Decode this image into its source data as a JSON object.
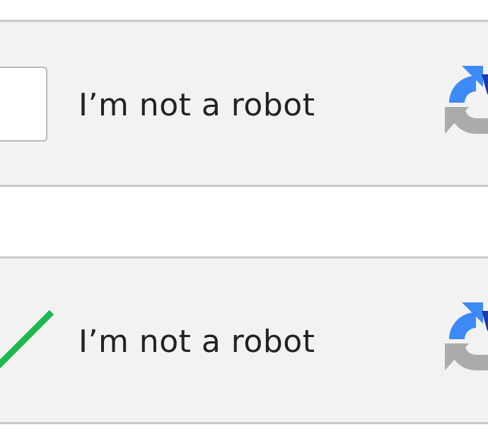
{
  "captcha_unchecked": {
    "label": "I’m not a robot",
    "checked": false
  },
  "captcha_checked": {
    "label": "I’m not a robot",
    "checked": true
  },
  "colors": {
    "widget_bg": "#f2f2f2",
    "widget_border": "#c9c9c9",
    "checkbox_border": "#b8b8b8",
    "check_green": "#1fb850",
    "logo_blue_light": "#3d8af7",
    "logo_blue_dark": "#1c3aa9",
    "logo_gray": "#ababab",
    "text": "#222222"
  },
  "icons": {
    "checkmark": "checkmark-icon",
    "logo": "recaptcha-logo-icon"
  }
}
